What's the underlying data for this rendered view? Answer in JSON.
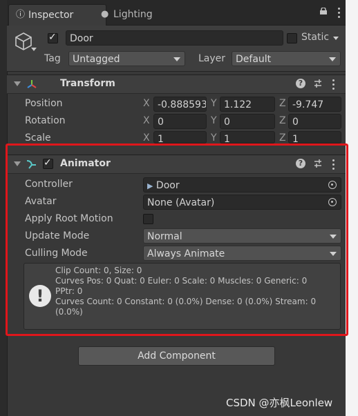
{
  "tabs": [
    {
      "label": "Inspector",
      "icon": "info-icon"
    },
    {
      "label": "Lighting",
      "icon": "bulb-icon"
    }
  ],
  "gameobject": {
    "active": true,
    "name": "Door",
    "static_label": "Static",
    "tag_label": "Tag",
    "tag_value": "Untagged",
    "layer_label": "Layer",
    "layer_value": "Default"
  },
  "transform": {
    "title": "Transform",
    "rows": [
      {
        "label": "Position",
        "x": "-0.888593",
        "y": "1.122",
        "z": "-9.747"
      },
      {
        "label": "Rotation",
        "x": "0",
        "y": "0",
        "z": "0"
      },
      {
        "label": "Scale",
        "x": "1",
        "y": "1",
        "z": "1"
      }
    ],
    "axis_x": "X",
    "axis_y": "Y",
    "axis_z": "Z"
  },
  "animator": {
    "enabled": true,
    "title": "Animator",
    "controller_label": "Controller",
    "controller_value": "Door",
    "avatar_label": "Avatar",
    "avatar_value": "None (Avatar)",
    "apply_root_motion_label": "Apply Root Motion",
    "apply_root_motion": false,
    "update_mode_label": "Update Mode",
    "update_mode_value": "Normal",
    "culling_mode_label": "Culling Mode",
    "culling_mode_value": "Always Animate",
    "info_lines": [
      "Clip Count: 0, Size: 0",
      "Curves Pos: 0 Quat: 0 Euler: 0 Scale: 0 Muscles: 0 Generic: 0",
      "PPtr: 0",
      "Curves Count: 0 Constant: 0 (0.0%) Dense: 0 (0.0%) Stream: 0",
      "(0.0%)"
    ]
  },
  "add_component_label": "Add Component",
  "watermark": "CSDN @亦枫Leonlew",
  "colors": {
    "highlight": "#e0161b",
    "background": "#383838"
  }
}
